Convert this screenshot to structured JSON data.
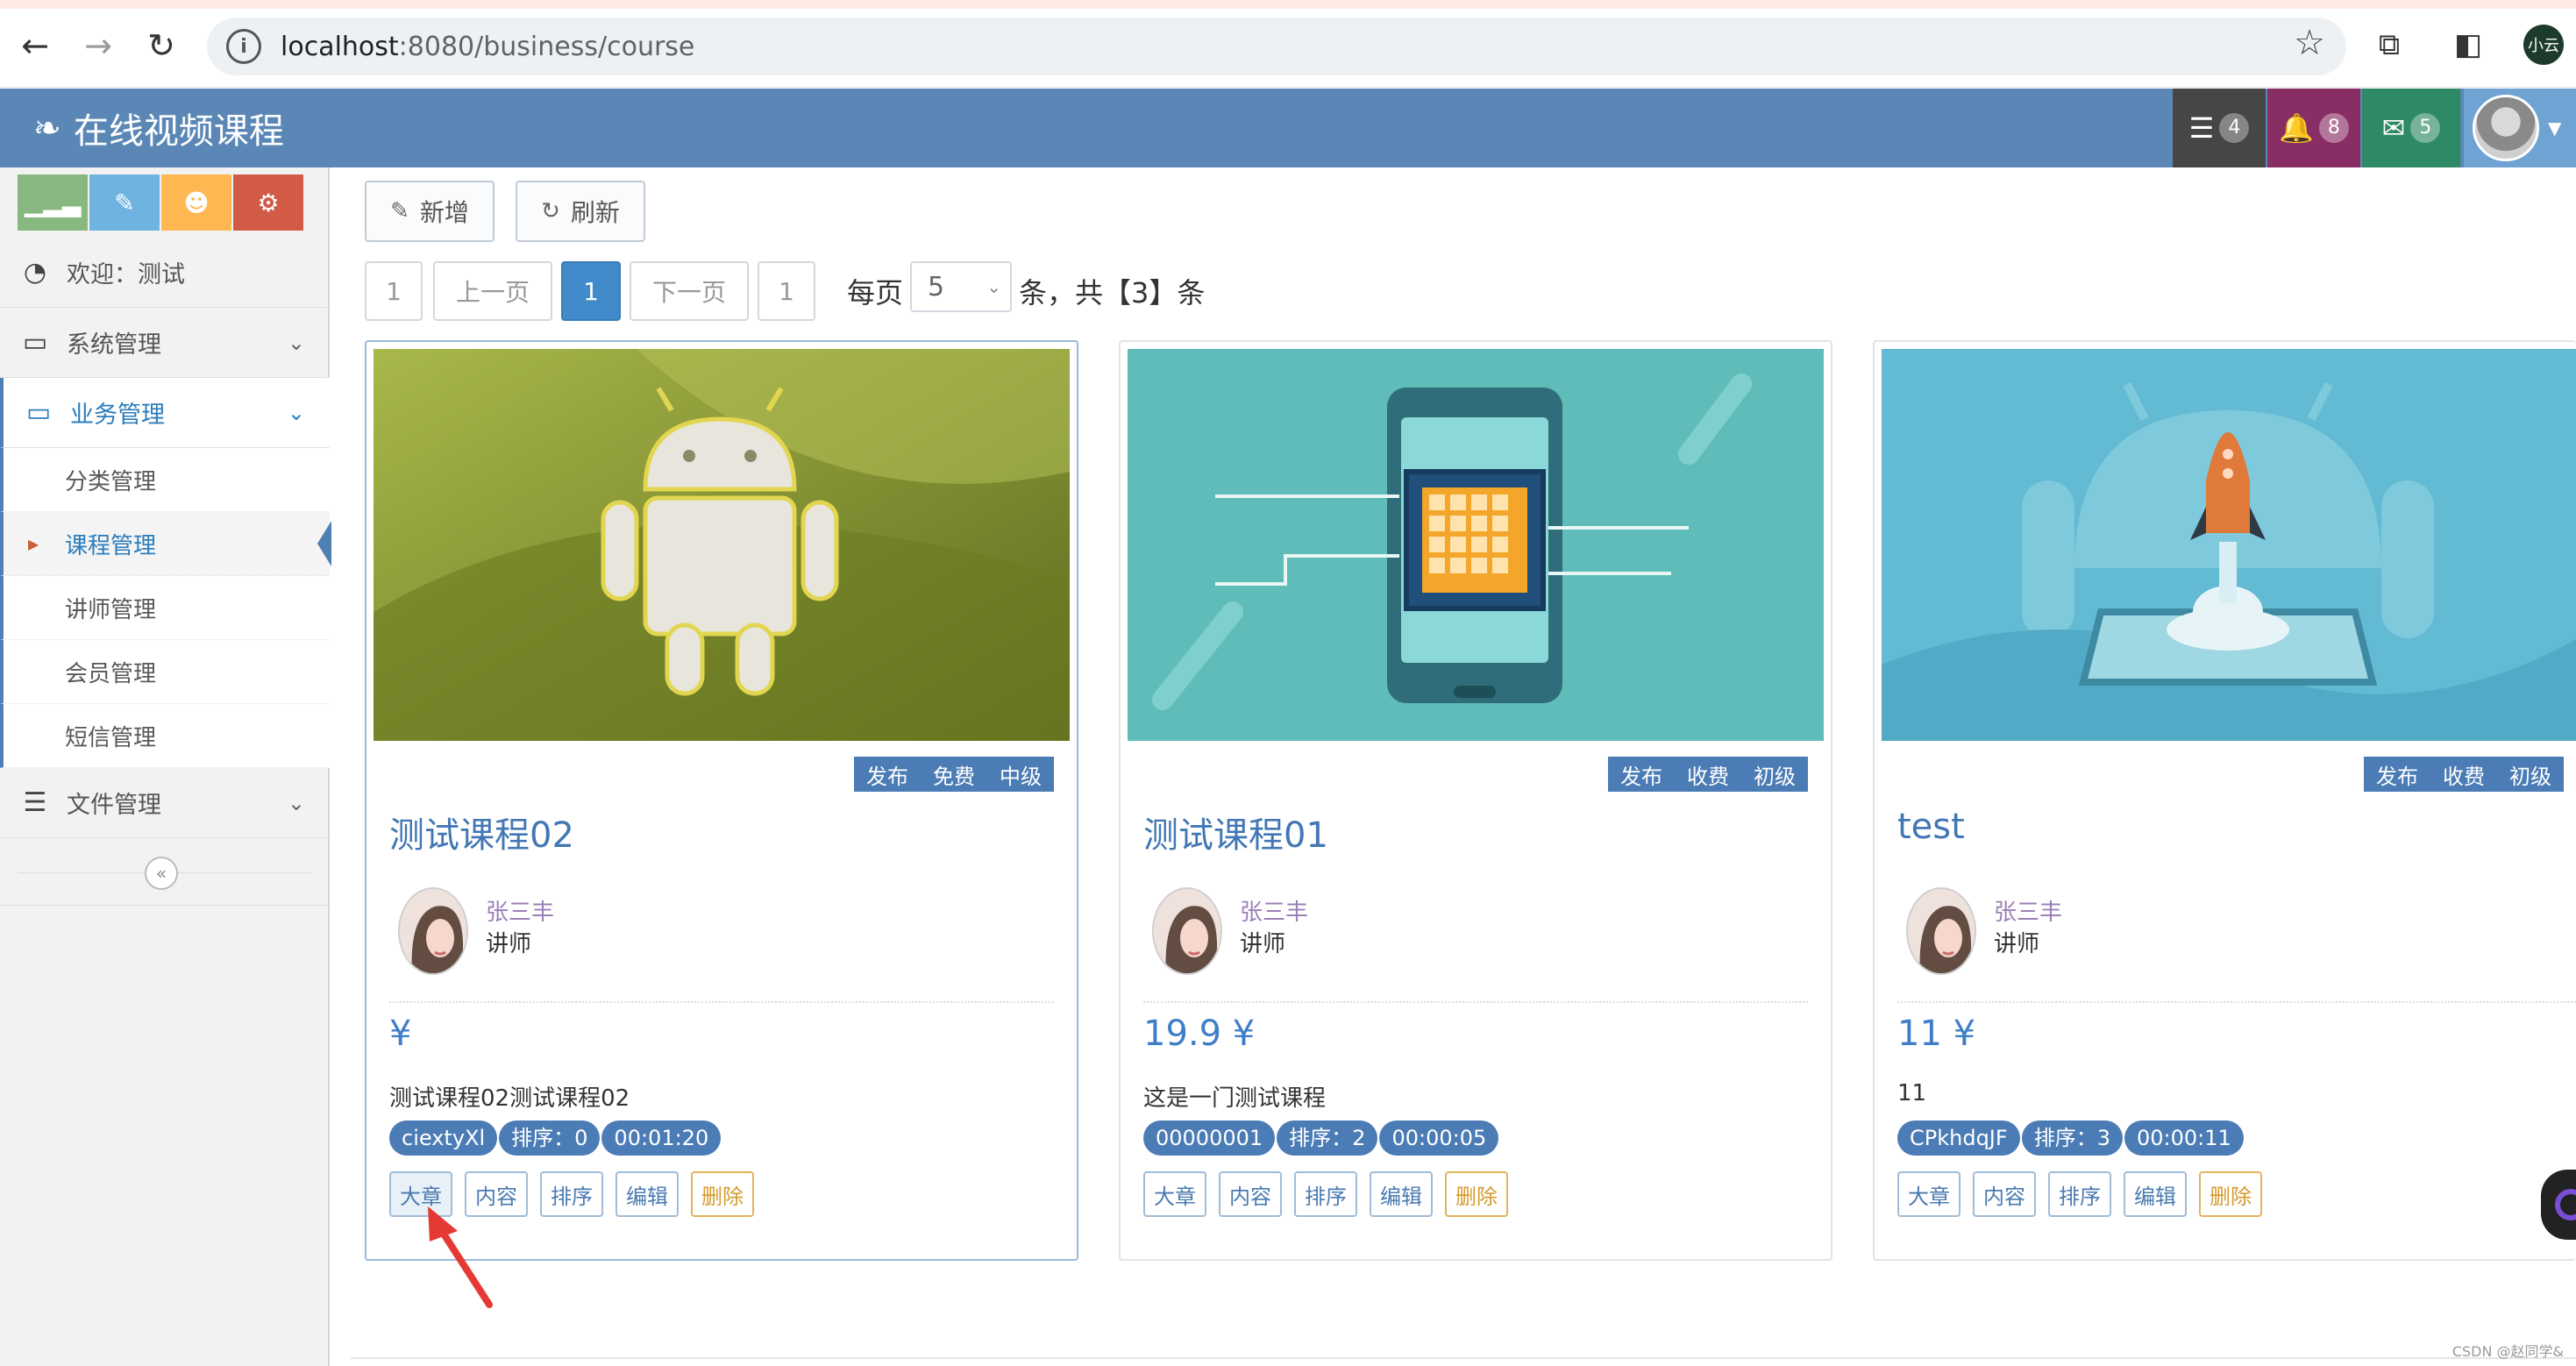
{
  "browser": {
    "url_host": "localhost",
    "url_path": ":8080/business/course",
    "profile_label": "小云"
  },
  "app": {
    "brand": "在线视频课程",
    "badges": [
      {
        "icon": "tasks-icon",
        "count": "4",
        "color": "#464646"
      },
      {
        "icon": "bell-icon",
        "count": "8",
        "color": "#892e65"
      },
      {
        "icon": "envelope-icon",
        "count": "5",
        "color": "#2e8965"
      }
    ]
  },
  "sidebar": {
    "shortcuts": [
      {
        "icon": "signal-icon",
        "color": "#87b87f"
      },
      {
        "icon": "pencil-icon",
        "color": "#6fb3e0"
      },
      {
        "icon": "users-icon",
        "color": "#ffb752"
      },
      {
        "icon": "cogs-icon",
        "color": "#d15b47"
      }
    ],
    "welcome": "欢迎：测试",
    "system": "系统管理",
    "business": "业务管理",
    "business_items": [
      "分类管理",
      "课程管理",
      "讲师管理",
      "会员管理",
      "短信管理"
    ],
    "file": "文件管理"
  },
  "toolbar": {
    "add": "新增",
    "refresh": "刷新"
  },
  "pager": {
    "first": "1",
    "prev": "上一页",
    "current": "1",
    "next": "下一页",
    "last": "1",
    "per_page": "每页",
    "size": "5",
    "suffix": "条，共【3】条"
  },
  "courses": [
    {
      "tags": [
        "发布",
        "免费",
        "中级"
      ],
      "title": "测试课程02",
      "teacher": "张三丰",
      "role": "讲师",
      "price": "¥",
      "summary": "测试课程02测试课程02",
      "chips": [
        "ciextyXl",
        "排序：0",
        "00:01:20"
      ],
      "actions": [
        "大章",
        "内容",
        "排序",
        "编辑",
        "删除"
      ]
    },
    {
      "tags": [
        "发布",
        "收费",
        "初级"
      ],
      "title": "测试课程01",
      "teacher": "张三丰",
      "role": "讲师",
      "price": "19.9 ¥",
      "summary": "这是一门测试课程",
      "chips": [
        "00000001",
        "排序：2",
        "00:00:05"
      ],
      "actions": [
        "大章",
        "内容",
        "排序",
        "编辑",
        "删除"
      ]
    },
    {
      "tags": [
        "发布",
        "收费",
        "初级"
      ],
      "title": "test",
      "teacher": "张三丰",
      "role": "讲师",
      "price": "11 ¥",
      "summary": "11",
      "chips": [
        "CPkhdqJF",
        "排序：3",
        "00:00:11"
      ],
      "actions": [
        "大章",
        "内容",
        "排序",
        "编辑",
        "删除"
      ]
    }
  ],
  "watermark": "CSDN @赵同学&",
  "colors": {
    "navbar": "#5b87b6",
    "accent": "#4b7cb5",
    "link": "#4277b4",
    "danger": "#d49a2e"
  }
}
